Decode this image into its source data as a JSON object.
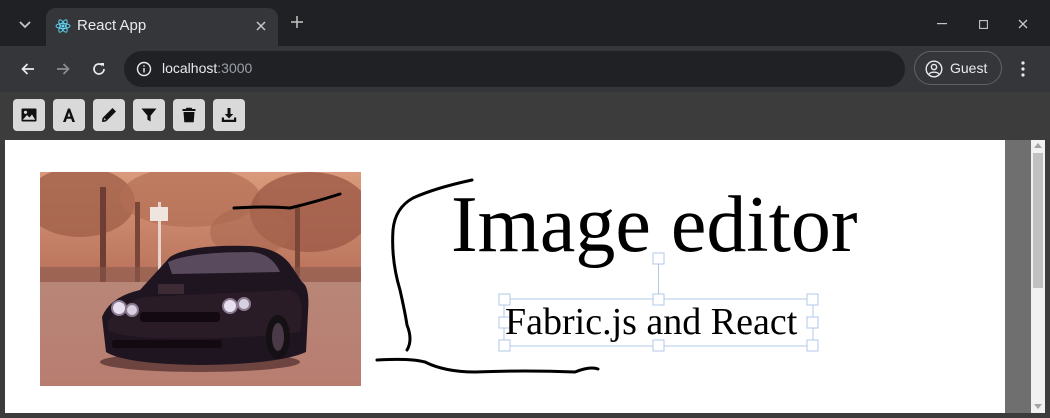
{
  "browser": {
    "tab_title": "React App",
    "url_host": "localhost",
    "url_port": ":3000",
    "profile_label": "Guest"
  },
  "toolbar": {
    "tools": [
      {
        "name": "image",
        "icon": "image-icon"
      },
      {
        "name": "text",
        "icon": "font-icon"
      },
      {
        "name": "draw",
        "icon": "pencil-icon"
      },
      {
        "name": "filter",
        "icon": "filter-icon"
      },
      {
        "name": "delete",
        "icon": "trash-icon"
      },
      {
        "name": "download",
        "icon": "download-icon"
      }
    ]
  },
  "canvas": {
    "headline": "Image editor",
    "subheading": "Fabric.js and React",
    "photo_subject": "car-photo"
  },
  "colors": {
    "chrome_dark": "#202124",
    "chrome_mid": "#35363a",
    "tool_button": "#d9d9d9",
    "selection": "#b0c8e8"
  }
}
